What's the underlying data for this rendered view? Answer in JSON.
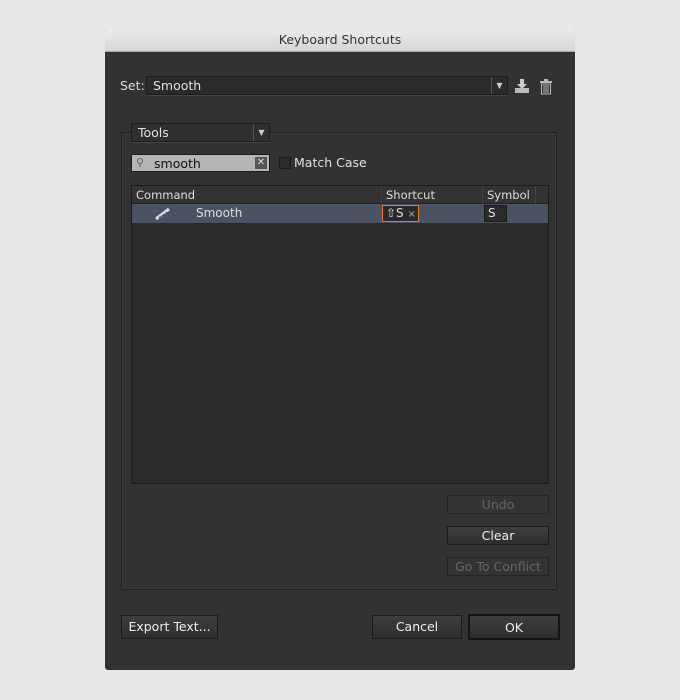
{
  "window": {
    "title": "Keyboard Shortcuts"
  },
  "set": {
    "label": "Set:",
    "value": "Smooth",
    "save_icon": "save-set-icon",
    "delete_icon": "trash-icon"
  },
  "category": {
    "value": "Tools"
  },
  "search": {
    "value": "smooth",
    "clear_icon": "clear-x-icon"
  },
  "match_case": {
    "label": "Match Case",
    "checked": false
  },
  "table": {
    "columns": [
      "Command",
      "Shortcut",
      "Symbol"
    ],
    "rows": [
      {
        "icon": "smooth-tool-icon",
        "command": "Smooth",
        "shortcut": "⇧S",
        "remove": "×",
        "symbol": "S",
        "selected": true
      }
    ]
  },
  "actions": {
    "undo": "Undo",
    "clear": "Clear",
    "go_to_conflict": "Go To Conflict"
  },
  "footer": {
    "export": "Export Text...",
    "cancel": "Cancel",
    "ok": "OK"
  },
  "colors": {
    "selection": "#4b5363",
    "shortcut_border": "#e07b28"
  }
}
